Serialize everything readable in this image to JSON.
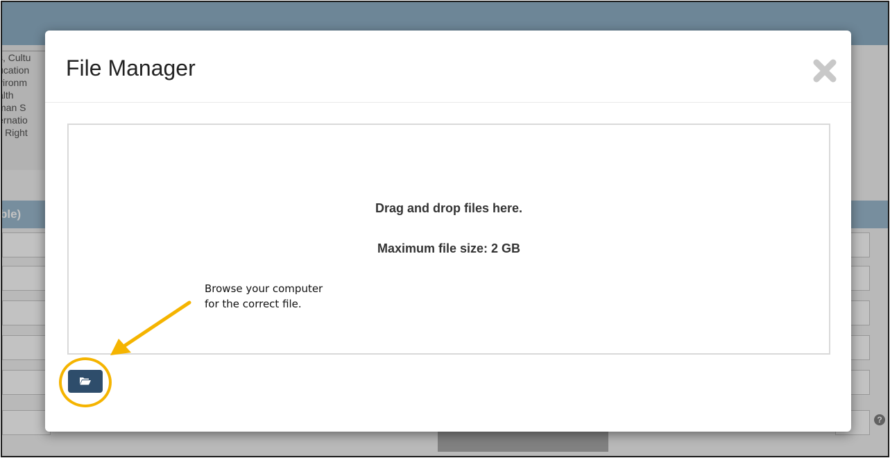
{
  "background": {
    "list_items": [
      "s, Cultu",
      "ucation",
      "vironm",
      "alth",
      "man S",
      "ernatio",
      "il Right"
    ],
    "section_header": "ble)",
    "help_icon": "question-circle-icon"
  },
  "modal": {
    "title": "File Manager",
    "close_icon": "close-x-icon",
    "dropzone": {
      "line1": "Drag and drop files here.",
      "line2": "Maximum file size: 2 GB"
    },
    "browse_icon": "folder-open-icon"
  },
  "annotation": {
    "line1": "Browse your computer",
    "line2": "for the correct file.",
    "color": "#f5b400"
  },
  "colors": {
    "browse_button": "#2e4d6b",
    "header_bar": "#7da3bd",
    "section_bar": "#8db0c8"
  }
}
